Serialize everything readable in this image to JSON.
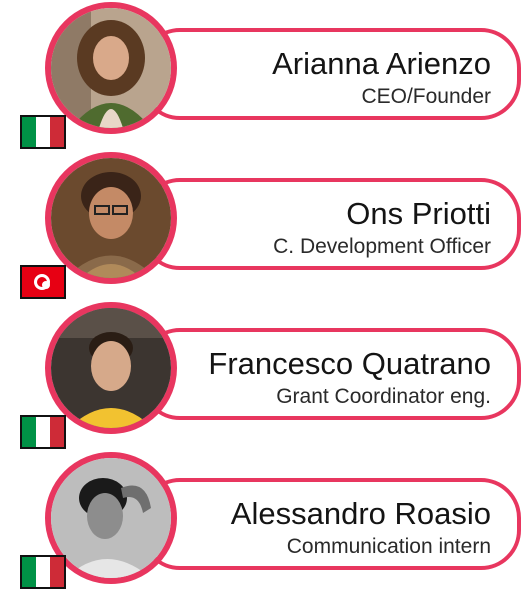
{
  "colors": {
    "accent": "#e8365f"
  },
  "team": [
    {
      "name": "Arianna Arienzo",
      "role": "CEO/Founder",
      "flag": "italy-flag-icon"
    },
    {
      "name": "Ons Priotti",
      "role": "C. Development Officer",
      "flag": "tunisia-flag-icon"
    },
    {
      "name": "Francesco Quatrano",
      "role": "Grant Coordinator eng.",
      "flag": "italy-flag-icon"
    },
    {
      "name": "Alessandro Roasio",
      "role": "Communication intern",
      "flag": "italy-flag-icon"
    }
  ]
}
